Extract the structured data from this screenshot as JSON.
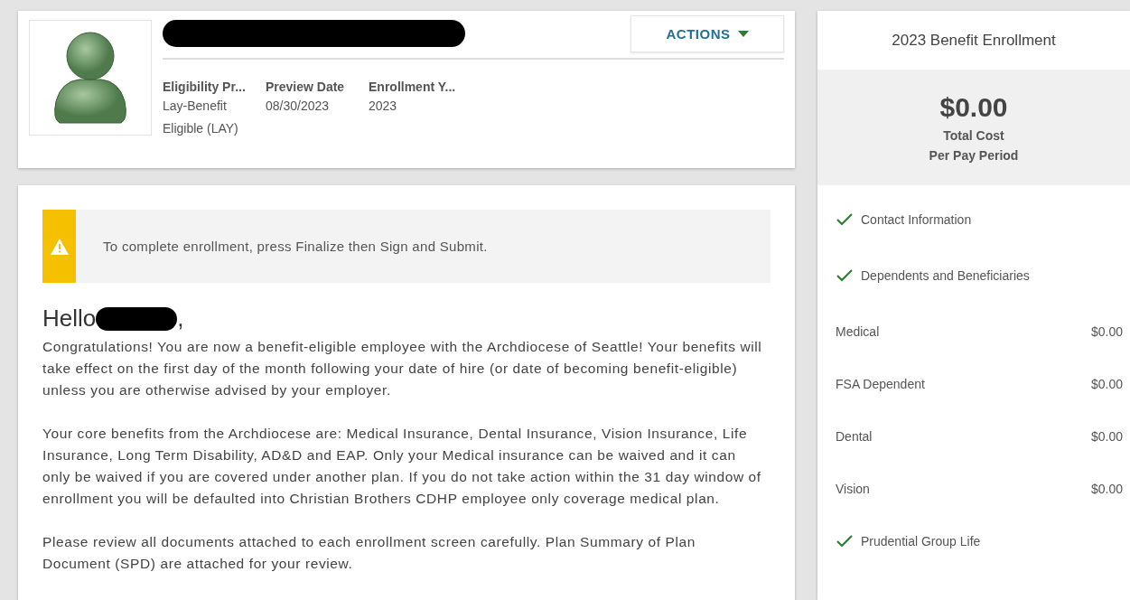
{
  "profile": {
    "name_redacted": true,
    "actions_label": "ACTIONS",
    "fields": [
      {
        "label": "Eligibility Pr...",
        "value": "Lay-Benefit Eligible (LAY)"
      },
      {
        "label": "Preview Date",
        "value": "08/30/2023"
      },
      {
        "label": "Enrollment Y...",
        "value": "2023"
      }
    ]
  },
  "alert": {
    "kind": "warning",
    "text": "To complete enrollment, press Finalize then Sign and Submit."
  },
  "greeting": {
    "text": "Hello",
    "name_redacted": true,
    "suffix": ","
  },
  "paragraphs": [
    "Congratulations! You are now a benefit-eligible employee with the Archdiocese of Seattle! Your benefits will take effect on the first day of the month following your date of hire (or date of becoming benefit-eligible) unless you are otherwise advised by your employer.",
    "Your core benefits from the Archdiocese are: Medical Insurance, Dental Insurance, Vision Insurance, Life Insurance, Long Term Disability, AD&D and EAP. Only your Medical insurance can be waived and it can only be waived if you are covered under another plan. If you do not take action within the 31 day window of enrollment you will be defaulted into Christian Brothers CDHP employee only coverage medical plan.",
    "Please review all documents attached to each enrollment screen carefully. Plan Summary of Plan Document (SPD) are attached for your review."
  ],
  "summary": {
    "title": "2023 Benefit Enrollment",
    "total": "$0.00",
    "total_label": "Total Cost",
    "period_label": "Per Pay Period",
    "items": [
      {
        "kind": "step",
        "label": "Contact Information",
        "complete": true
      },
      {
        "kind": "step",
        "label": "Dependents and Beneficiaries",
        "complete": true
      },
      {
        "kind": "cost",
        "label": "Medical",
        "amount": "$0.00"
      },
      {
        "kind": "cost",
        "label": "FSA Dependent",
        "amount": "$0.00"
      },
      {
        "kind": "cost",
        "label": "Dental",
        "amount": "$0.00"
      },
      {
        "kind": "cost",
        "label": "Vision",
        "amount": "$0.00"
      },
      {
        "kind": "step",
        "label": "Prudential Group Life",
        "complete": true
      }
    ]
  }
}
